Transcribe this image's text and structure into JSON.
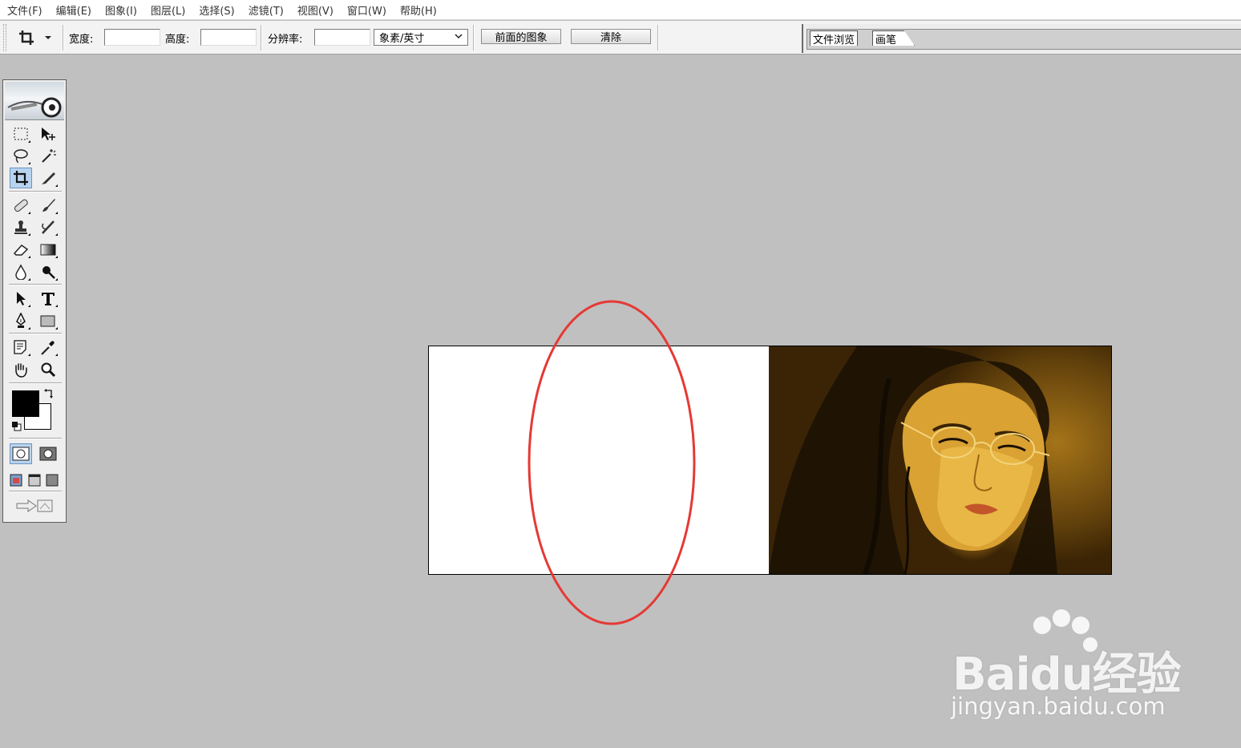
{
  "menu": {
    "items": [
      {
        "label": "文件(F)"
      },
      {
        "label": "编辑(E)"
      },
      {
        "label": "图象(I)"
      },
      {
        "label": "图层(L)"
      },
      {
        "label": "选择(S)"
      },
      {
        "label": "滤镜(T)"
      },
      {
        "label": "视图(V)"
      },
      {
        "label": "窗口(W)"
      },
      {
        "label": "帮助(H)"
      }
    ]
  },
  "options": {
    "tool_icon": "crop-icon",
    "width_label": "宽度:",
    "width_value": "",
    "height_label": "高度:",
    "height_value": "",
    "resolution_label": "分辨率:",
    "resolution_value": "",
    "unit_selected": "象素/英寸",
    "front_image_button": "前面的图象",
    "clear_button": "清除"
  },
  "palette_well": {
    "tabs": [
      {
        "label": "文件浏览"
      },
      {
        "label": "画笔"
      }
    ]
  },
  "toolbox": {
    "active_tool": "crop-tool",
    "foreground_color": "#000000",
    "background_color": "#ffffff"
  },
  "document": {
    "background": "#ffffff",
    "image_description_colors": [
      "#3a2405",
      "#a57419",
      "#e8b33c"
    ]
  },
  "annotation": {
    "ellipse_color": "#e53935"
  },
  "watermark": {
    "brand": "Baidu经验",
    "url": "jingyan.baidu.com"
  }
}
